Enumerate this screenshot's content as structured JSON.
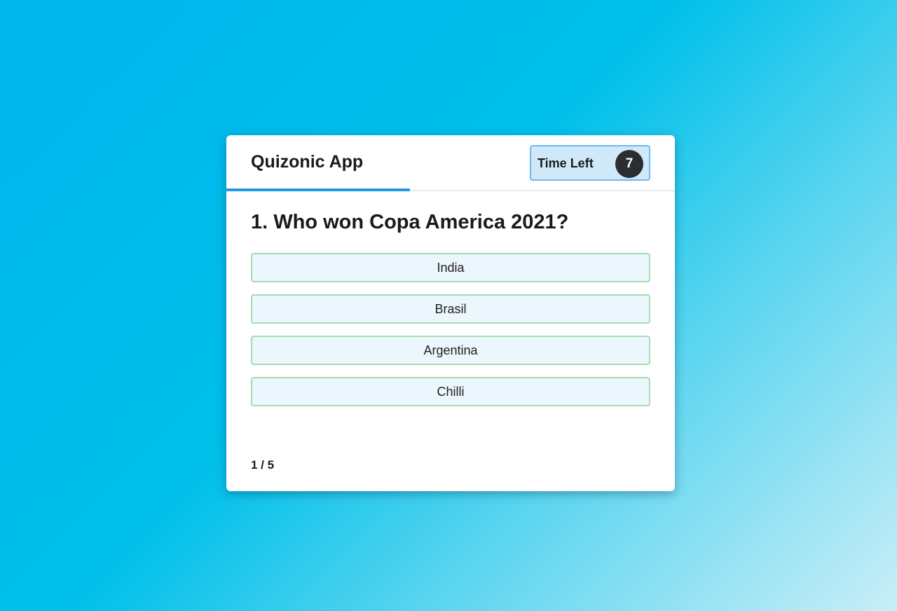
{
  "app": {
    "title": "Quizonic App"
  },
  "timer": {
    "label": "Time Left",
    "seconds": "7"
  },
  "progress": {
    "fraction": 0.41
  },
  "question": {
    "text": "1. Who won Copa America 2021?",
    "options": [
      {
        "label": "India"
      },
      {
        "label": "Brasil"
      },
      {
        "label": "Argentina"
      },
      {
        "label": "Chilli"
      }
    ]
  },
  "pagination": {
    "text": "1 / 5"
  },
  "colors": {
    "accent": "#1f97e8",
    "option_border": "#a5dcaf",
    "option_bg": "#ebf6fd",
    "timer_bg": "#cfe9fb",
    "timer_border": "#74b8ea",
    "timer_badge": "#2b2d30"
  }
}
